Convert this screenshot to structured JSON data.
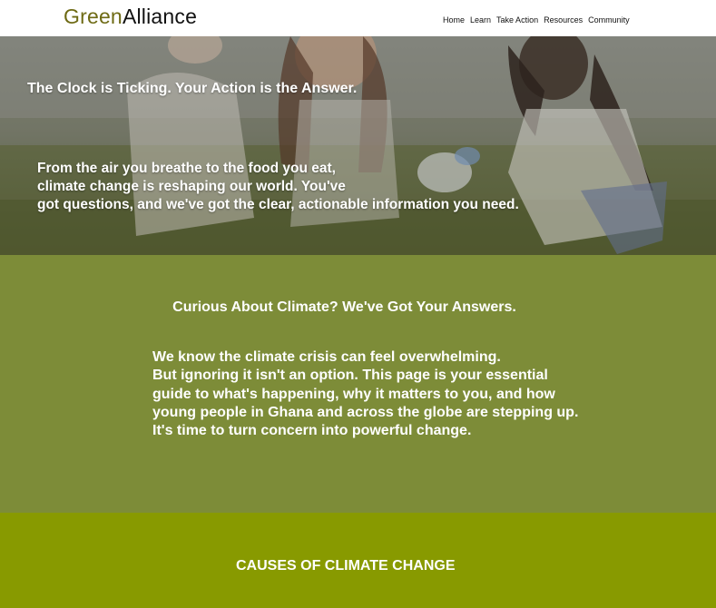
{
  "header": {
    "logo_green": "Green",
    "logo_rest": "Alliance",
    "nav": [
      "Home",
      "Learn",
      "Take Action",
      "Resources",
      "Community"
    ]
  },
  "hero": {
    "title": "The Clock is Ticking. Your Action is the Answer.",
    "lines": [
      "From the air you breathe to the food you eat,",
      "climate change is reshaping our world. You've",
      "got questions, and we've got the clear, actionable information you need."
    ]
  },
  "intro": {
    "title": "Curious About Climate? We've Got Your Answers.",
    "lines": [
      "We know the climate crisis can feel overwhelming.",
      "But ignoring it isn't an option. This page is your essential",
      "guide to what's happening, why it matters to you, and how",
      "young people in Ghana and across the globe are stepping up.",
      "It's time to turn concern into powerful change."
    ]
  },
  "causes": {
    "title": "CAUSES OF CLIMATE CHANGE"
  },
  "colors": {
    "logo_accent": "#6e6a14",
    "intro_bg": "#7d8c38",
    "causes_bg": "#889a00"
  }
}
